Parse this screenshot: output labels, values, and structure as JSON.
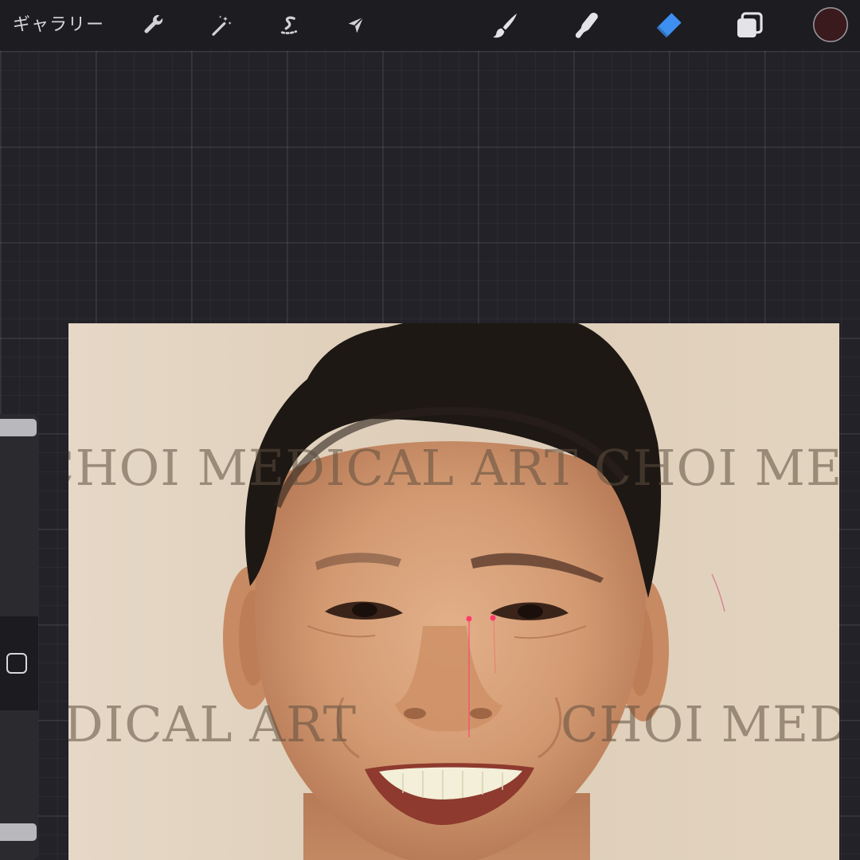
{
  "toolbar": {
    "gallery_label": "ギャラリー",
    "actions_icon": "wrench-icon",
    "adjustments_icon": "magic-wand-icon",
    "selection_icon": "selection-s-icon",
    "transform_icon": "arrow-cursor-icon",
    "brush_icon": "paintbrush-icon",
    "smudge_icon": "smudge-finger-icon",
    "eraser_icon": "eraser-icon",
    "layers_icon": "layers-icon",
    "active_tool": "eraser",
    "active_color": "#3a1a1d",
    "accent_color": "#3d8ff0"
  },
  "canvas": {
    "watermark_1": "CHOI MEDICAL ART",
    "watermark_2": "CHOI MEDI",
    "watermark_3": "DICAL ART",
    "watermark_4": "CHOI MEDI",
    "guide_color": "#ff3b6b"
  },
  "sidebar": {
    "size_slider_icon": "slider-handle",
    "modify_button_icon": "square-outline-icon"
  }
}
